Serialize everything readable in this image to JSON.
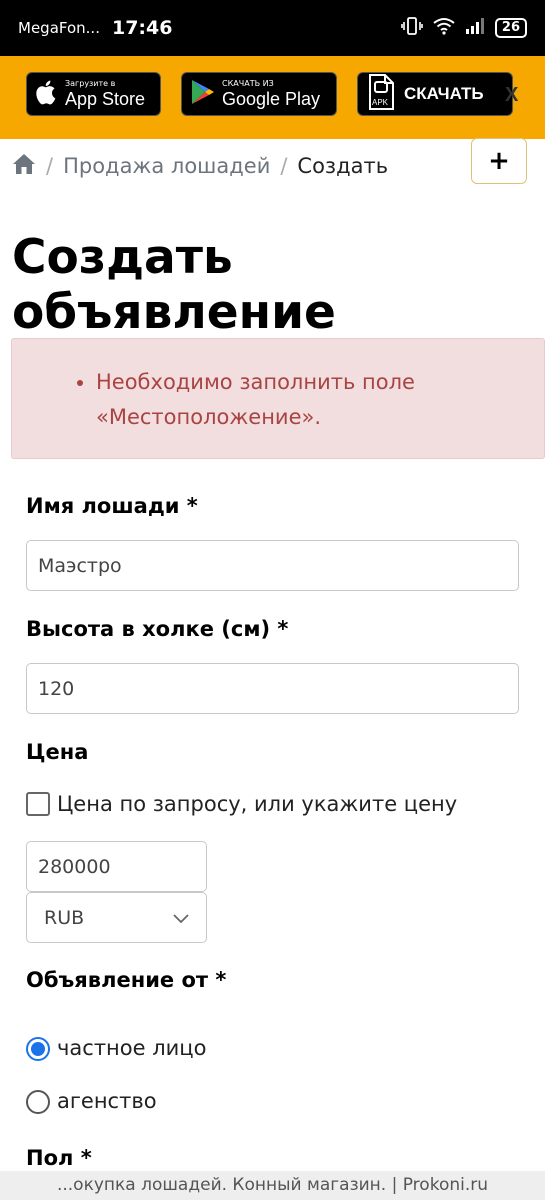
{
  "status_bar": {
    "carrier": "MegaFon...",
    "time": "17:46",
    "battery": "26",
    "icons": [
      "vibrate-icon",
      "wifi-icon",
      "signal-icon",
      "battery-icon"
    ]
  },
  "app_banner": {
    "appstore": {
      "small": "Загрузите в",
      "big": "App Store"
    },
    "googleplay": {
      "small": "СКАЧАТЬ ИЗ",
      "big": "Google Play"
    },
    "apk": {
      "badge": "APK",
      "label": "СКАЧАТЬ"
    },
    "close": "X"
  },
  "breadcrumb": {
    "home_icon": "home-icon",
    "items": [
      "Продажа лошадей",
      "Создать"
    ],
    "separator": "/"
  },
  "add_button": "+",
  "page_title": "Создать объявление",
  "alert": {
    "errors": [
      "Необходимо заполнить поле «Местоположение»."
    ]
  },
  "form": {
    "horse_name": {
      "label": "Имя лошади *",
      "value": "Маэстро"
    },
    "height": {
      "label": "Высота в холке (см) *",
      "value": "120"
    },
    "price": {
      "label": "Цена",
      "on_request_label": "Цена по запросу, или укажите цену",
      "value": "280000",
      "currency": "RUB"
    },
    "seller": {
      "label": "Объявление от *",
      "options": [
        {
          "label": "частное лицо",
          "checked": true
        },
        {
          "label": "агенство",
          "checked": false
        }
      ]
    },
    "sex": {
      "label": "Пол *"
    }
  },
  "footer": "...окупка лошадей. Конный магазин. | Prokoni.ru",
  "colors": {
    "banner": "#f6a800",
    "alert_bg": "#f2dedf",
    "alert_text": "#a94442",
    "radio_accent": "#1a73e8"
  }
}
